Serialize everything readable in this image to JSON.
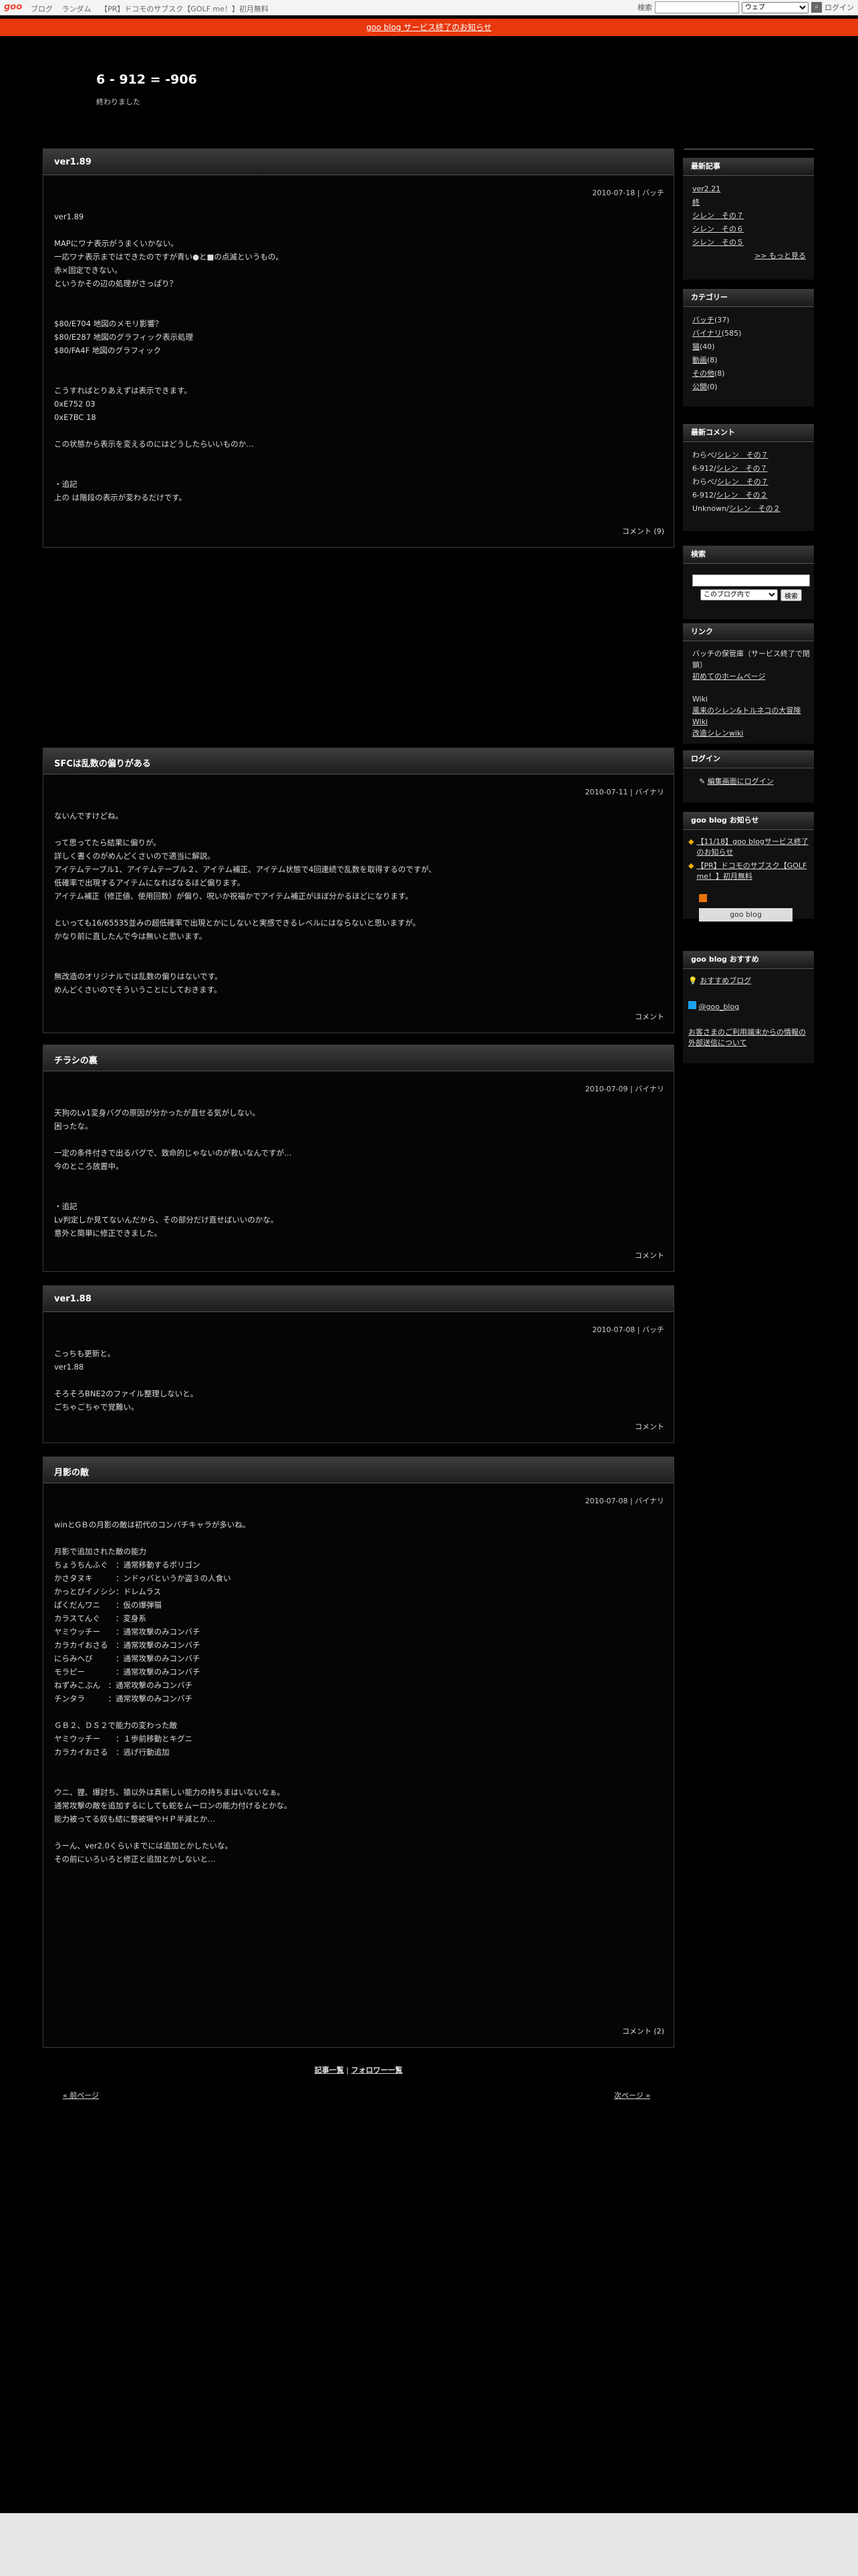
{
  "topbar": {
    "logo": "goo",
    "links": [
      "ブログ",
      "ランダム",
      "【PR】ドコモのサブスク【GOLF me！】初月無料"
    ],
    "search_label": "検索",
    "search_scope": "ウェブ",
    "login": "ログイン"
  },
  "notice": "goo blog サービス終了のお知らせ",
  "header": {
    "title": "6 - 912 = -906",
    "desc": "終わりました"
  },
  "entries": [
    {
      "title": "ver1.89",
      "meta": "2010-07-18 | バッチ",
      "lines": [
        "ver1.89",
        "",
        "MAPにワナ表示がうまくいかない。",
        "一応ワナ表示まではできたのですが青い●と■の点滅というもの。",
        "赤×固定できない。",
        "というかその辺の処理がさっぱり？",
        "",
        "",
        "$80/E704 地図のメモリ影響？",
        "$80/E287 地図のグラフィック表示処理",
        "$80/FA4F 地図のグラフィック",
        "",
        "",
        "こうすればとりあえずは表示できます。",
        "0xE752 03",
        "0xE7BC 18",
        "",
        "この状態から表示を変えるのにはどうしたらいいものか…",
        "",
        "",
        "・追記",
        "上の は階段の表示が変わるだけです。"
      ],
      "footer": "コメント (9)"
    },
    {
      "title": "SFCは乱数の偏りがある",
      "meta": "2010-07-11 | バイナリ",
      "lines": [
        "ないんですけどね。",
        "",
        "って思ってたら結果に偏りが。",
        "詳しく書くのがめんどくさいので適当に解説。",
        "アイテムテーブル1、アイテムテーブル２、アイテム補正、アイテム状態で4回連続で乱数を取得するのですが、",
        "低確率で出現するアイテムになればなるほど偏ります。",
        "アイテム補正（修正値、使用回数）が偏り、呪いか祝福かでアイテム補正がほぼ分かるほどになります。",
        "",
        "といっても16/65535並みの超低確率で出現とかにしないと実感できるレベルにはならないと思いますが。",
        "かなり前に直したんで今は無いと思います。",
        "",
        "",
        "無改造のオリジナルでは乱数の偏りはないです。",
        "めんどくさいのでそういうことにしておきます。"
      ],
      "footer": "コメント"
    },
    {
      "title": "チラシの裏",
      "meta": "2010-07-09 | バイナリ",
      "lines": [
        "天狗のLv1変身バグの原因が分かったが直せる気がしない。",
        "困ったな。",
        "",
        "一定の条件付きで出るバグで、致命的じゃないのが救いなんですが…",
        "今のところ放置中。",
        "",
        "",
        "・追記",
        "Lv判定しか見てないんだから、その部分だけ直せばいいのかな。",
        "意外と簡単に修正できました。"
      ],
      "footer": "コメント"
    },
    {
      "title": "ver1.88",
      "meta": "2010-07-08 | バッチ",
      "lines": [
        "こっちも更新と。",
        "ver1.88",
        "",
        "そろそろBNE2のファイル整理しないと。",
        "ごちゃごちゃで覚難い。"
      ],
      "footer": "コメント"
    },
    {
      "title": "月影の敵",
      "meta": "2010-07-08 | バイナリ",
      "lines": [
        "winとGＢの月影の敵は初代のコンバチキャラが多いね。",
        "",
        "月影で追加された敵の能力",
        "ちょうちんふぐ　：通常移動するポリゴン",
        "かさタヌキ　　　：ンドゥバというか盗３の人食い",
        "かっとびイノシシ：ドレムラス",
        "ぱくだんワニ　　：仮の爆弾猫",
        "カラスてんぐ　　：変身系",
        "ヤミウッチー　　：通常攻撃のみコンバチ",
        "カラカイおさる　：通常攻撃のみコンバチ",
        "にらみへび　　　：通常攻撃のみコンバチ",
        "モラピー　　　　：通常攻撃のみコンバチ",
        "ねずみこぶん　：通常攻撃のみコンバチ",
        "チンタラ　　　：通常攻撃のみコンバチ",
        "",
        "ＧＢ２、ＤＳ２で能力の変わった敵",
        "ヤミウッチー　　：１歩前移動とキグニ",
        "カラカイおさる　：逃げ行動追加",
        "",
        "",
        "ウニ、狸、爆討ち、猿以外は真新しい能力の持ちまはいないなぁ。",
        "通常攻撃の敵を追加するにしても蛇をムーロンの能力付けるとかな。",
        "能力被ってる奴も結に整被場やＨＰ半減とか…",
        "",
        "うーん、ver2.0くらいまでには追加とかしたいな。",
        "その前にいろいろと修正と追加とかしないと…"
      ],
      "footer": "コメント (2)"
    }
  ],
  "pager": {
    "list": "記事一覧",
    "sep": "|",
    "follower": "フォロワー一覧",
    "prev": "« 前ページ",
    "next": "次ページ »"
  },
  "side": {
    "recent": {
      "head": "最新記事",
      "items": [
        "ver2.21",
        "終",
        "シレン　その７",
        "シレン　その６",
        "シレン　その５"
      ],
      "more": ">> もっと見る"
    },
    "category": {
      "head": "カテゴリー",
      "items": [
        [
          "バッチ",
          "(37)"
        ],
        [
          "バイナリ",
          "(585)"
        ],
        [
          "猫",
          "(40)"
        ],
        [
          "動画",
          "(8)"
        ],
        [
          "その他",
          "(8)"
        ],
        [
          "公開",
          "(0)"
        ]
      ]
    },
    "comments": {
      "head": "最新コメント",
      "items": [
        [
          "わらべ/",
          "シレン　その７"
        ],
        [
          "6-912/",
          "シレン　その７"
        ],
        [
          "わらべ/",
          "シレン　その７"
        ],
        [
          "6-912/",
          "シレン　その２"
        ],
        [
          "Unknown/",
          "シレン　その２"
        ]
      ]
    },
    "search": {
      "head": "検索",
      "scope": "このブログ内で",
      "btn": "検索"
    },
    "links": {
      "head": "リンク",
      "lines": [
        "バッチの保管庫（サービス終了で閉鎖）",
        "初めてのホームページ",
        "",
        "Wiki",
        "風来のシレン&トルネコの大冒険 Wiki",
        "改造シレンwiki"
      ]
    },
    "login": {
      "head": "ログイン",
      "item": "編集画面にログイン"
    },
    "info": {
      "head": "goo blog お知らせ",
      "items": [
        "【11/18】goo blogサービス終了のお知らせ",
        "【PR】ドコモのサブスク【GOLF me！】初月無料"
      ],
      "badge": "goo blog"
    },
    "recommend": {
      "head": "goo blog おすすめ",
      "items": [
        "おすすめブログ",
        "@goo_blog",
        "お客さまのご利用端末からの情報の外部送信について"
      ]
    }
  }
}
